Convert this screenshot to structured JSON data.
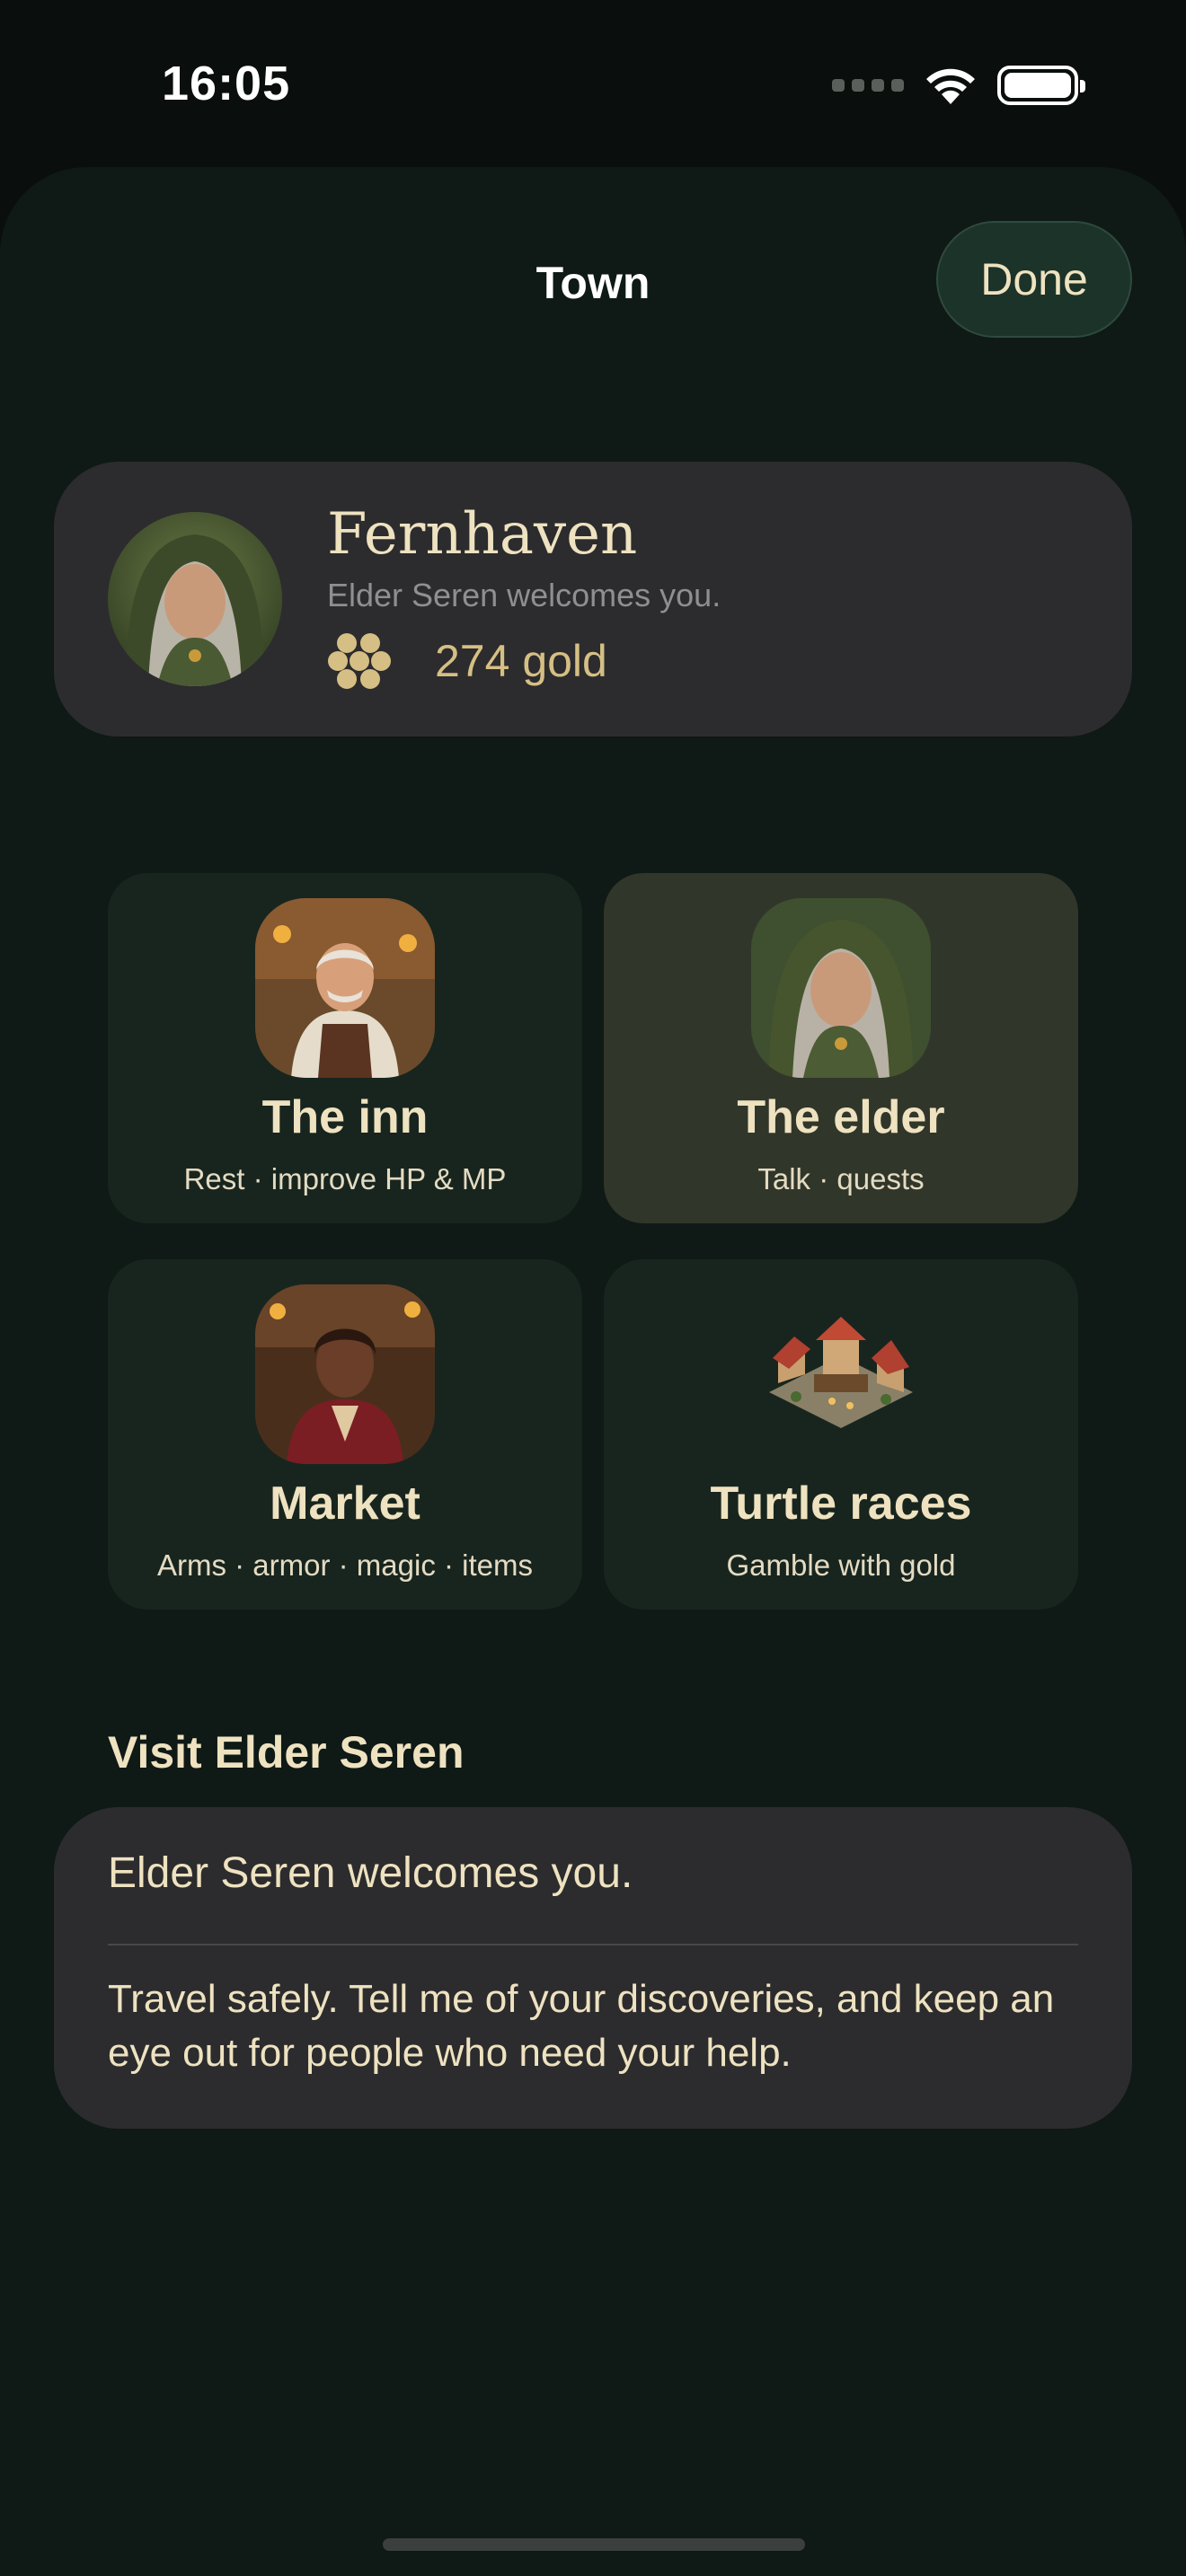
{
  "status_bar": {
    "time": "16:05"
  },
  "nav": {
    "title": "Town",
    "done_label": "Done"
  },
  "town": {
    "name": "Fernhaven",
    "welcome": "Elder Seren welcomes you.",
    "gold": "274 gold"
  },
  "tiles": [
    {
      "title": "The inn",
      "subtitle": "Rest · improve HP & MP",
      "selected": false
    },
    {
      "title": "The elder",
      "subtitle": "Talk · quests",
      "selected": true
    },
    {
      "title": "Market",
      "subtitle": "Arms · armor · magic · items",
      "selected": false
    },
    {
      "title": "Turtle races",
      "subtitle": "Gamble with gold",
      "selected": false
    }
  ],
  "visit": {
    "section_title": "Visit Elder Seren",
    "greeting": "Elder Seren welcomes you.",
    "message": "Travel safely. Tell me of your discoveries, and keep an eye out for people who need your help."
  },
  "colors": {
    "accent_text": "#eee2c0",
    "gold": "#d6bf84",
    "card": "#2c2c2e",
    "tile": "#18251f",
    "tile_selected": "#31362a"
  }
}
